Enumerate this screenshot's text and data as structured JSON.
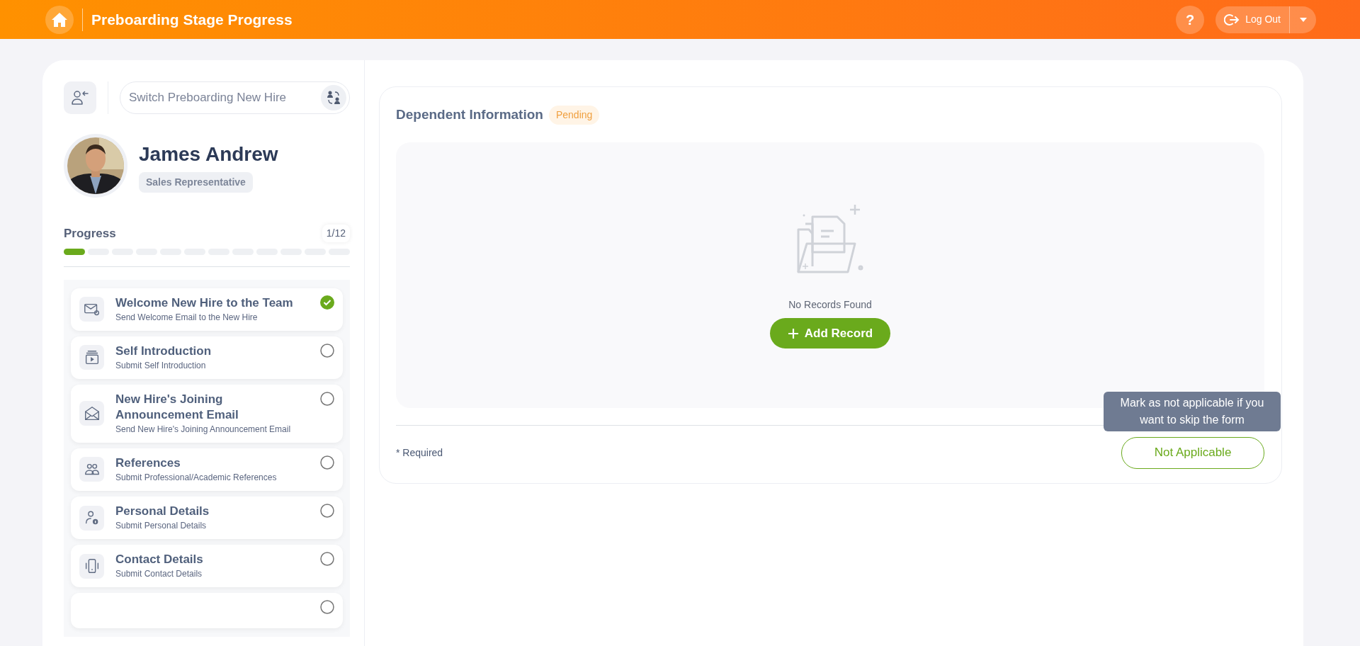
{
  "header": {
    "title": "Preboarding Stage Progress",
    "logout": "Log Out",
    "help": "?"
  },
  "switcher": {
    "placeholder": "Switch Preboarding New Hire"
  },
  "profile": {
    "name": "James Andrew",
    "role": "Sales Representative"
  },
  "progress": {
    "label": "Progress",
    "count": "1/12",
    "segments": [
      {
        "complete": true
      },
      {
        "complete": false
      },
      {
        "complete": false
      },
      {
        "complete": false
      },
      {
        "complete": false
      },
      {
        "complete": false
      },
      {
        "complete": false
      },
      {
        "complete": false
      },
      {
        "complete": false
      },
      {
        "complete": false
      },
      {
        "complete": false
      },
      {
        "complete": false
      }
    ]
  },
  "tasks": [
    {
      "kind": "welcome",
      "title": "Welcome New Hire to the Team",
      "subtitle": "Send Welcome Email to the New Hire",
      "completed": true
    },
    {
      "kind": "video",
      "title": "Self Introduction",
      "subtitle": "Submit Self Introduction",
      "completed": false
    },
    {
      "kind": "mail",
      "title": "New Hire's Joining Announcement Email",
      "subtitle": "Send New Hire's Joining Announcement Email",
      "completed": false
    },
    {
      "kind": "people",
      "title": "References",
      "subtitle": "Submit Professional/Academic References",
      "completed": false
    },
    {
      "kind": "person",
      "title": "Personal Details",
      "subtitle": "Submit Personal Details",
      "completed": false
    },
    {
      "kind": "phone",
      "title": "Contact Details",
      "subtitle": "Submit Contact Details",
      "completed": false
    },
    {
      "kind": "partial",
      "completed": false
    }
  ],
  "form": {
    "title": "Dependent Information",
    "status": "Pending",
    "empty_text": "No Records Found",
    "add_button": "Add Record",
    "required_note": "* Required",
    "na_button": "Not Applicable",
    "tooltip": "Mark as not applicable if you want to skip the form"
  }
}
